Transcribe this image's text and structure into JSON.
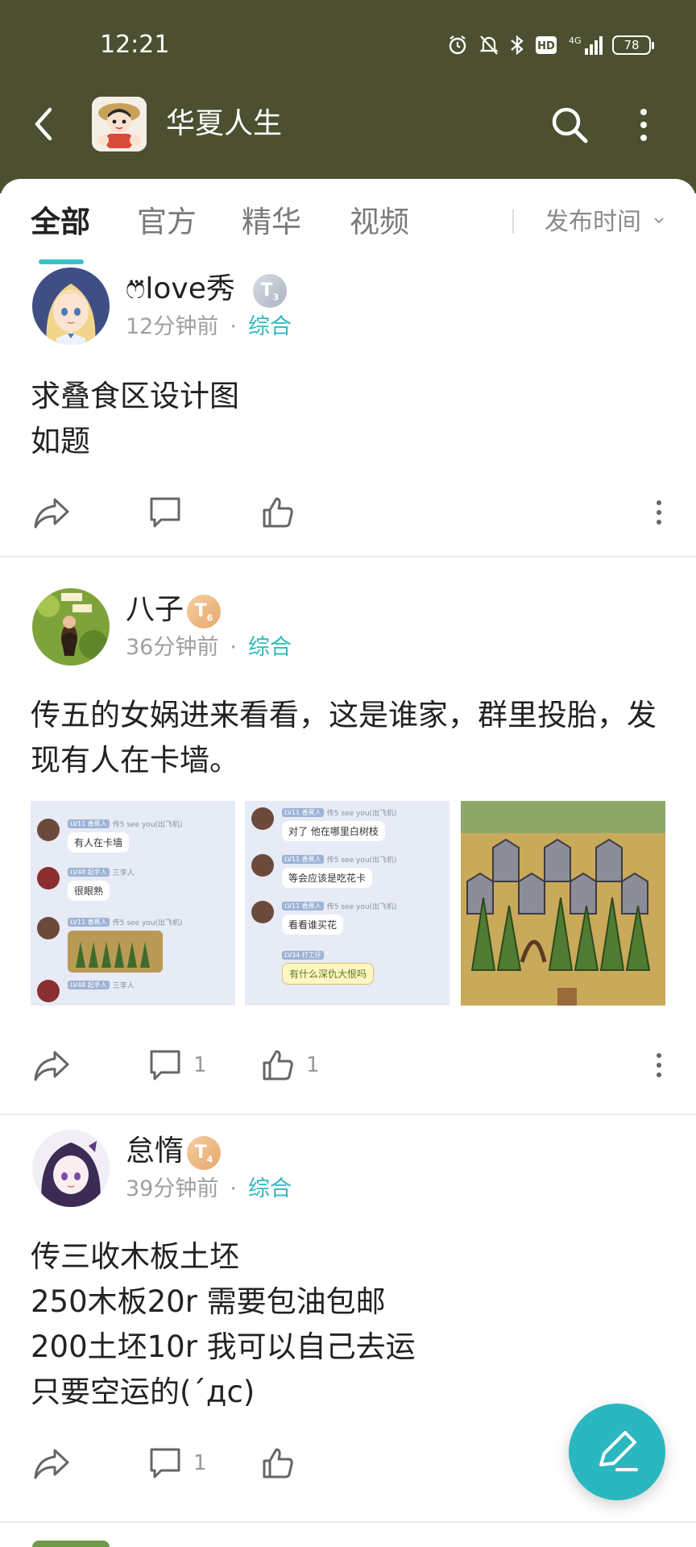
{
  "status_bar": {
    "time": "12:21",
    "battery": "78",
    "network": "4G",
    "hd": "HD",
    "icons": [
      "alarm-icon",
      "mute-icon",
      "bluetooth-icon",
      "hd-icon",
      "signal-icon",
      "battery-icon"
    ]
  },
  "header": {
    "title": "华夏人生",
    "back_icon": "chevron-left-icon",
    "search_icon": "search-icon",
    "more_icon": "vertical-dots-icon",
    "background": "#4c4f30"
  },
  "tabs": [
    {
      "label": "全部",
      "active": true
    },
    {
      "label": "官方",
      "active": false
    },
    {
      "label": "精华",
      "active": false
    },
    {
      "label": "视频",
      "active": false
    }
  ],
  "sort": {
    "label": "发布时间"
  },
  "accent_color": "#35c1c5",
  "posts": [
    {
      "author": "ෆ⃛love秀",
      "badge": "T",
      "badge_level": "3",
      "time": "12分钟前",
      "separator": "·",
      "category": "综合",
      "body": "求叠食区设计图\n如题",
      "comment_count": "",
      "like_count": ""
    },
    {
      "author": "八子",
      "badge": "T",
      "badge_level": "6",
      "time": "36分钟前",
      "separator": "·",
      "category": "综合",
      "body": "传五的女娲进来看看，这是谁家，群里投胎，发现有人在卡墙。",
      "comment_count": "1",
      "like_count": "1",
      "images": [
        {
          "messages": [
            {
              "tag": "LV11 香蕉人",
              "sender": "传5 see you(出飞机)",
              "text": "有人在卡墙"
            },
            {
              "tag": "LV48 起手人",
              "sender": "三李人",
              "text": "很眼熟"
            },
            {
              "tag": "LV11 香蕉人",
              "sender": "传5 see you(出飞机)",
              "text": ""
            },
            {
              "tag": "LV48 起手人",
              "sender": "三李人",
              "text": ""
            }
          ]
        },
        {
          "messages": [
            {
              "tag": "LV11 香蕉人",
              "sender": "传5 see you(出飞机)",
              "text": "对了  他在哪里白树枝"
            },
            {
              "tag": "LV11 香蕉人",
              "sender": "传5 see you(出飞机)",
              "text": "等会应该是吃花卡"
            },
            {
              "tag": "LV11 香蕉人",
              "sender": "传5 see you(出飞机)",
              "text": "看看谁买花"
            },
            {
              "tag": "LV34 打工仔",
              "sender": "",
              "text": "有什么深仇大恨吗"
            }
          ]
        },
        {
          "scene": "game-screenshot"
        }
      ]
    },
    {
      "author": "怠惰",
      "badge": "T",
      "badge_level": "4",
      "time": "39分钟前",
      "separator": "·",
      "category": "综合",
      "body": "传三收木板土坯\n250木板20r 需要包油包邮\n200土坯10r 我可以自己去运\n只要空运的(´дc)",
      "comment_count": "1",
      "like_count": ""
    }
  ],
  "action_icons": [
    "share-icon",
    "comment-icon",
    "like-icon",
    "more-icon"
  ],
  "fab": {
    "icon": "edit-pen-icon"
  }
}
